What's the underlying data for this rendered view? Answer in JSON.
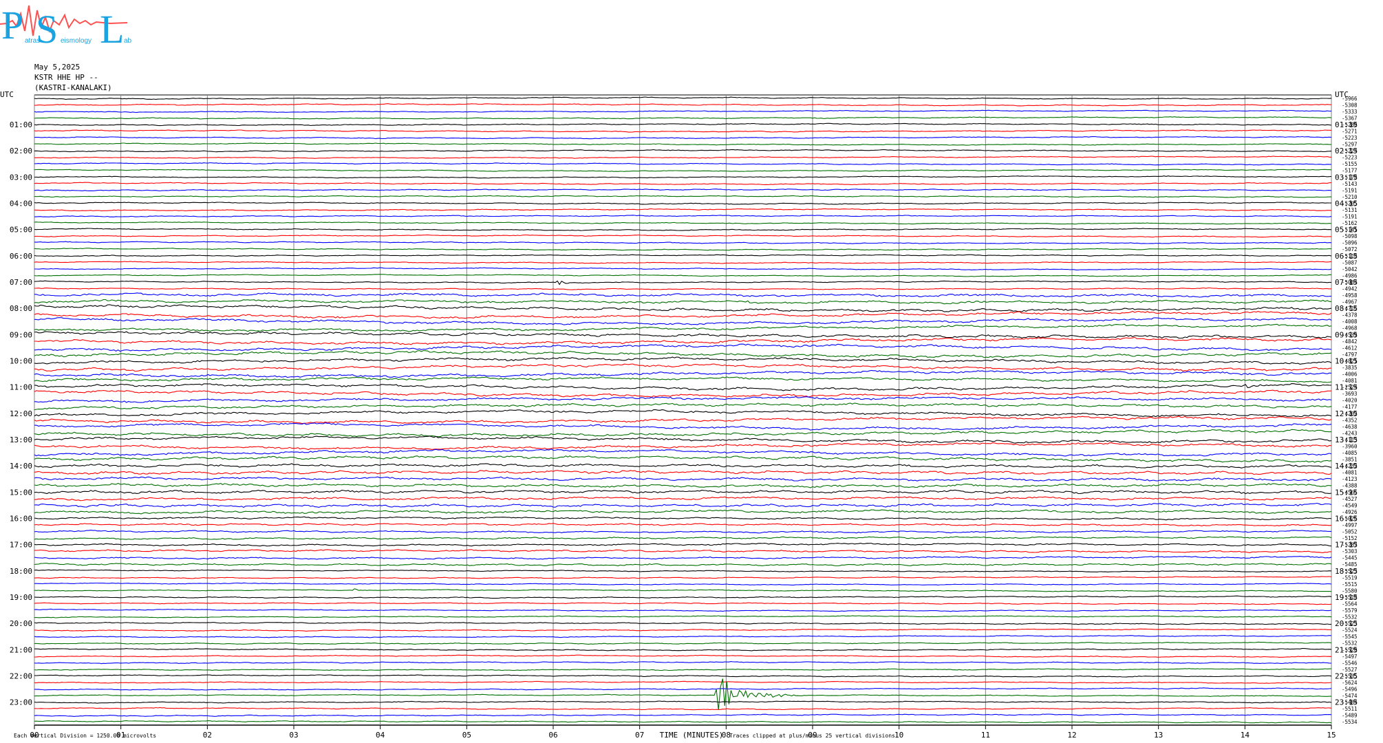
{
  "header": {
    "date": "May 5,2025",
    "station": "KSTR HHE HP --",
    "location": "(KASTRI-KANALAKI)"
  },
  "logo": {
    "letters": [
      "P",
      "S",
      "L"
    ],
    "words": [
      "atras",
      "eismology",
      "ab"
    ]
  },
  "colors": {
    "trace_cycle": [
      "#000000",
      "#ff0000",
      "#0000ff",
      "#007000"
    ],
    "grid": "#808080",
    "logo_cyan": "#19a3e0",
    "logo_red": "#ff5050"
  },
  "chart_data": {
    "type": "line",
    "description": "helicorder",
    "left_axis_label": "UTC",
    "right_axis_label": "UTC",
    "left_hour_labels": [
      "01:00",
      "02:00",
      "03:00",
      "04:00",
      "05:00",
      "06:00",
      "07:00",
      "08:00",
      "09:00",
      "10:00",
      "11:00",
      "12:00",
      "13:00",
      "14:00",
      "15:00",
      "16:00",
      "17:00",
      "18:00",
      "19:00",
      "20:00",
      "21:00",
      "22:00",
      "23:00"
    ],
    "right_hour_labels": [
      "01:15",
      "02:15",
      "03:15",
      "04:15",
      "05:15",
      "06:15",
      "07:15",
      "08:15",
      "09:15",
      "10:15",
      "11:15",
      "12:15",
      "13:15",
      "14:15",
      "15:15",
      "16:15",
      "17:15",
      "18:15",
      "19:15",
      "20:15",
      "21:15",
      "22:15",
      "23:15"
    ],
    "x_ticks": [
      "00",
      "01",
      "02",
      "03",
      "04",
      "05",
      "06",
      "07",
      "08",
      "09",
      "10",
      "11",
      "12",
      "13",
      "14",
      "15"
    ],
    "xlabel": "TIME (MINUTES)",
    "xlim": [
      0,
      15
    ],
    "traces_per_hour": 4,
    "trace_count": 96,
    "offsets": [
      "-5966",
      "-5308",
      "-5333",
      "-5367",
      "-5280",
      "-5271",
      "-5223",
      "-5297",
      "-5224",
      "-5223",
      "-5155",
      "-5177",
      "-5178",
      "-5143",
      "-5191",
      "-5210",
      "-5205",
      "-5131",
      "-5191",
      "-5162",
      "-5141",
      "-5098",
      "-5096",
      "-5072",
      "-5118",
      "-5087",
      "-5042",
      "-4986",
      "-5084",
      "-4942",
      "-4958",
      "-4967",
      "-4716",
      "-4378",
      "-4008",
      "-4968",
      "-4539",
      "-4842",
      "-4612",
      "-4797",
      "-4821",
      "-3835",
      "-4006",
      "-4081",
      "-2524",
      "-3693",
      "-4020",
      "-4177",
      "-4202",
      "-4352",
      "-4638",
      "-4243",
      "-4113",
      "-3960",
      "-4085",
      "-3851",
      "-4232",
      "-4081",
      "-4123",
      "-4388",
      "-4566",
      "-4527",
      "-4549",
      "-4926",
      "-5026",
      "-4997",
      "-5052",
      "-5152",
      "-5287",
      "-5303",
      "-5445",
      "-5485",
      "-5523",
      "-5519",
      "-5515",
      "-5580",
      "-5518",
      "-5564",
      "-5579",
      "-5532",
      "-5523",
      "-5524",
      "-5545",
      "-5532",
      "-5520",
      "-5497",
      "-5546",
      "-5527",
      "-5535",
      "-5624",
      "-5496",
      "-5474",
      "-5484",
      "-5511",
      "-5489",
      "-5534"
    ],
    "events": [
      {
        "trace": 28,
        "minute": 6.05,
        "amp": 14,
        "width": 0.08
      },
      {
        "trace": 31,
        "minute": 8.25,
        "amp": 3,
        "width": 0.06
      },
      {
        "trace": 35,
        "minute": 12.6,
        "amp": 3,
        "width": 0.06
      },
      {
        "trace": 44,
        "minute": 14.0,
        "amp": 4,
        "width": 0.3
      },
      {
        "trace": 75,
        "minute": 3.7,
        "amp": 4,
        "width": 0.02
      },
      {
        "trace": 91,
        "minute": 7.9,
        "amp": 30,
        "width": 0.6
      }
    ],
    "vertical_division": "Each Vertical Division = 1250.00 microvolts",
    "clipping_note": "Traces clipped at plus/minus 25 vertical divisions"
  }
}
